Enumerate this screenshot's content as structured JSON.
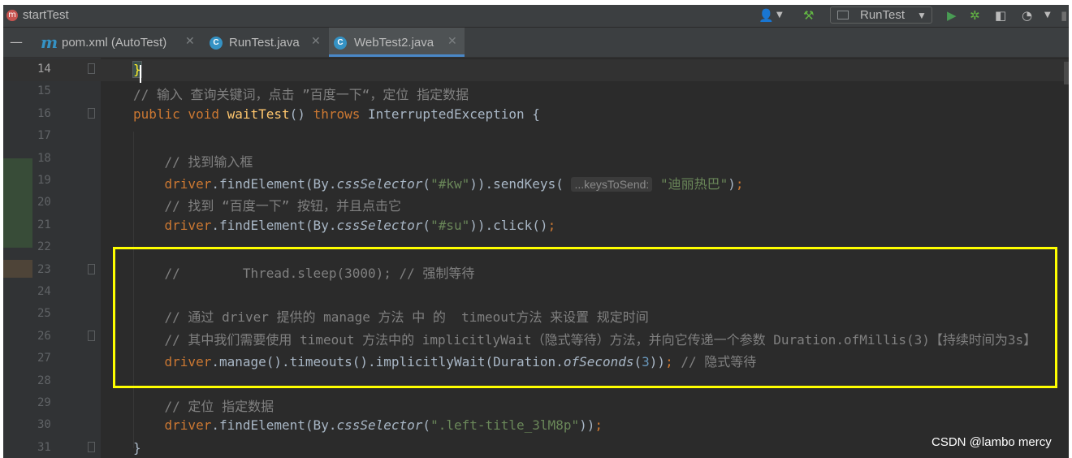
{
  "window": {
    "project_icon": "m",
    "project_name": "startTest",
    "run_config": "RunTest",
    "icons": [
      "user-icon",
      "chevron-down-icon",
      "build-hammer-icon",
      "run-icon",
      "debug-icon",
      "coverage-icon",
      "profiler-icon",
      "more-chevron-icon"
    ]
  },
  "tabs": [
    {
      "label": "pom.xml (AutoTest)",
      "icon": "maven-icon",
      "active": false
    },
    {
      "label": "RunTest.java",
      "icon": "java-class-icon",
      "active": false
    },
    {
      "label": "WebTest2.java",
      "icon": "java-class-icon",
      "active": true
    }
  ],
  "editor": {
    "lines": [
      {
        "num": "14",
        "parts": [
          {
            "t": "}",
            "c": "brace-hl"
          }
        ]
      },
      {
        "num": "15",
        "parts": [
          {
            "t": "// 输入 查询关键词，点击 ”百度一下“，定位 指定数据",
            "c": "cm"
          }
        ]
      },
      {
        "num": "16",
        "parts": [
          {
            "t": "public void ",
            "c": "kw"
          },
          {
            "t": "waitTest",
            "c": "fn"
          },
          {
            "t": "() ",
            "c": ""
          },
          {
            "t": "throws ",
            "c": "kw"
          },
          {
            "t": "InterruptedException {",
            "c": ""
          }
        ]
      },
      {
        "num": "17",
        "parts": []
      },
      {
        "num": "18",
        "parts": [
          {
            "t": "    // 找到输入框",
            "c": "cm"
          }
        ]
      },
      {
        "num": "19",
        "parts": [
          {
            "t": "    driver",
            "c": "kw"
          },
          {
            "t": ".findElement(By.",
            "c": ""
          },
          {
            "t": "cssSelector",
            "c": "it"
          },
          {
            "t": "(",
            "c": ""
          },
          {
            "t": "\"#kw\"",
            "c": "st"
          },
          {
            "t": ")).sendKeys( ",
            "c": ""
          },
          {
            "t": "...keysToSend:",
            "c": "hint"
          },
          {
            "t": " ",
            "c": ""
          },
          {
            "t": "\"迪丽热巴\"",
            "c": "st"
          },
          {
            "t": ")",
            "c": ""
          },
          {
            "t": ";",
            "c": "kw"
          }
        ]
      },
      {
        "num": "20",
        "parts": [
          {
            "t": "    // 找到 “百度一下” 按钮，并且点击它",
            "c": "cm"
          }
        ]
      },
      {
        "num": "21",
        "parts": [
          {
            "t": "    driver",
            "c": "kw"
          },
          {
            "t": ".findElement(By.",
            "c": ""
          },
          {
            "t": "cssSelector",
            "c": "it"
          },
          {
            "t": "(",
            "c": ""
          },
          {
            "t": "\"#su\"",
            "c": "st"
          },
          {
            "t": ")).click()",
            "c": ""
          },
          {
            "t": ";",
            "c": "kw"
          }
        ]
      },
      {
        "num": "22",
        "parts": []
      },
      {
        "num": "23",
        "parts": [
          {
            "t": "    //        Thread.sleep(3000); // 强制等待",
            "c": "cm"
          }
        ]
      },
      {
        "num": "24",
        "parts": []
      },
      {
        "num": "25",
        "parts": [
          {
            "t": "    // 通过 driver 提供的 manage 方法 中 的  timeout方法 来设置 规定时间",
            "c": "cm"
          }
        ]
      },
      {
        "num": "26",
        "parts": [
          {
            "t": "    // 其中我们需要使用 timeout 方法中的 implicitlyWait（隐式等待）方法，并向它传递一个参数 Duration.ofMillis(3)【持续时间为3s】",
            "c": "cm"
          }
        ]
      },
      {
        "num": "27",
        "parts": [
          {
            "t": "    driver",
            "c": "kw"
          },
          {
            "t": ".manage().timeouts().implicitlyWait(Duration.",
            "c": ""
          },
          {
            "t": "ofSeconds",
            "c": "it"
          },
          {
            "t": "(",
            "c": ""
          },
          {
            "t": "3",
            "c": "num"
          },
          {
            "t": "))",
            "c": ""
          },
          {
            "t": "; ",
            "c": "kw"
          },
          {
            "t": "// 隐式等待",
            "c": "cm"
          }
        ]
      },
      {
        "num": "28",
        "parts": []
      },
      {
        "num": "29",
        "parts": [
          {
            "t": "    // 定位 指定数据",
            "c": "cm"
          }
        ]
      },
      {
        "num": "30",
        "parts": [
          {
            "t": "    driver",
            "c": "kw"
          },
          {
            "t": ".findElement(By.",
            "c": ""
          },
          {
            "t": "cssSelector",
            "c": "it"
          },
          {
            "t": "(",
            "c": ""
          },
          {
            "t": "\".left-title_3lM8p\"",
            "c": "st"
          },
          {
            "t": "))",
            "c": ""
          },
          {
            "t": ";",
            "c": "kw"
          }
        ]
      },
      {
        "num": "31",
        "parts": [
          {
            "t": "}",
            "c": ""
          }
        ]
      }
    ]
  },
  "watermark": "CSDN @lambo mercy",
  "colors": {
    "keyword": "#cc7832",
    "method": "#ffc66d",
    "comment": "#808080",
    "string": "#6a8759",
    "number": "#6897bb",
    "highlight_box": "#ffff00",
    "active_tab_underline": "#4a88c7"
  }
}
